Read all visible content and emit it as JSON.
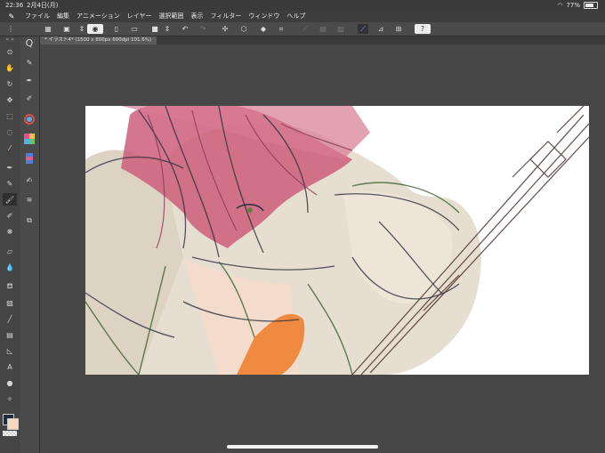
{
  "status": {
    "time": "22:36",
    "date": "2月4日(月)",
    "battery": "77%",
    "battery_level": 0.77
  },
  "menu": [
    "ファイル",
    "編集",
    "アニメーション",
    "レイヤー",
    "選択範囲",
    "表示",
    "フィルター",
    "ウィンドウ",
    "ヘルプ"
  ],
  "document_tab": {
    "title": "* イラスト4* (1500 x 800px 600dpi 101.6%)"
  },
  "colors": {
    "main_color": "#1f2a3a",
    "sub_color": "#f6d8c2"
  },
  "icons": {
    "command_bar": [
      "menu-grid-icon",
      "layout-icon",
      "view-icon",
      "new-file-icon",
      "open-file-icon",
      "save-icon",
      "undo-icon",
      "redo-icon",
      "transform-icon",
      "clear-icon",
      "fill-icon",
      "crop-icon",
      "ruler-icon",
      "snap-icon",
      "layer-snap-icon",
      "perspective-icon",
      "help-icon"
    ],
    "tools": [
      "zoom-icon",
      "hand-icon",
      "rotate-icon",
      "move-icon",
      "select-rect-icon",
      "lasso-icon",
      "eyedropper-icon",
      "pen-icon",
      "pencil-icon",
      "brush-icon",
      "airbrush-icon",
      "decoration-icon",
      "eraser-icon",
      "blend-icon",
      "fill-bucket-icon",
      "gradient-icon",
      "figure-icon",
      "frame-icon",
      "ruler-tool-icon",
      "text-icon",
      "balloon-icon",
      "correction-icon"
    ],
    "subtools": [
      "brush-sub-1-icon",
      "brush-sub-2-icon",
      "brush-sub-3-icon",
      "color-wheel-icon",
      "color-set-icon",
      "intermediate-color-icon",
      "similar-color-icon",
      "color-history-icon",
      "layer-property-icon",
      "layer-icon",
      "navigator-icon"
    ]
  }
}
